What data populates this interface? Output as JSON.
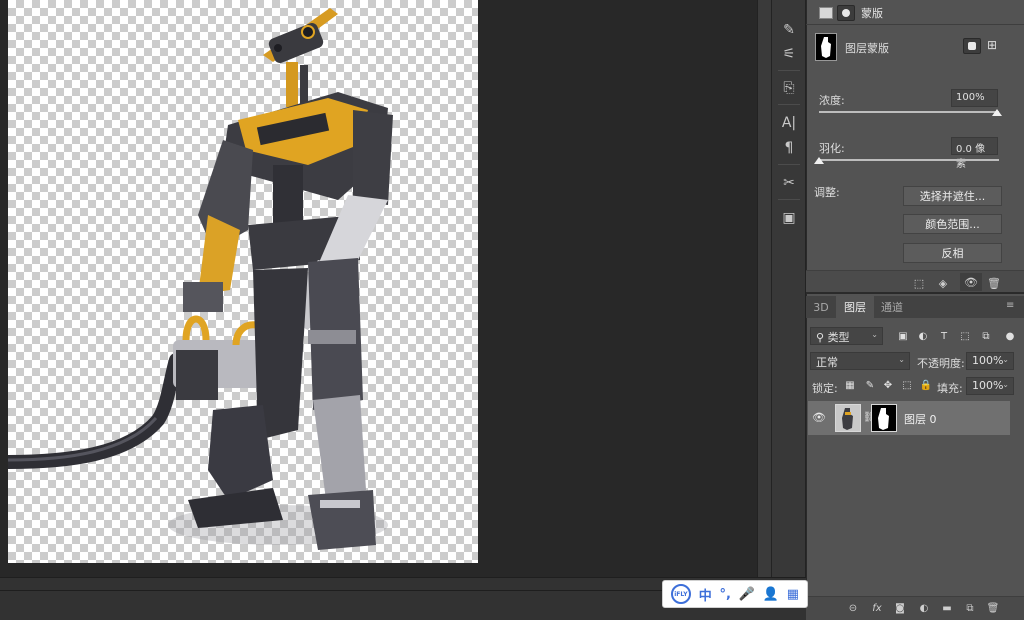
{
  "properties": {
    "header_label": "蒙版",
    "mask_title": "图层蒙版",
    "density_label": "浓度:",
    "density_value": "100%",
    "feather_label": "羽化:",
    "feather_value": "0.0 像素",
    "refine_label": "调整:",
    "select_and_mask_button": "选择并遮住...",
    "color_range_button": "颜色范围...",
    "invert_button": "反相"
  },
  "layers": {
    "tabs": [
      "3D",
      "图层",
      "通道"
    ],
    "active_tab": "图层",
    "filter_kind": "类型",
    "blend_mode": "正常",
    "opacity_label": "不透明度:",
    "opacity_value": "100%",
    "lock_label": "锁定:",
    "fill_label": "填充:",
    "fill_value": "100%",
    "layer_name": "图层 0"
  },
  "ime": {
    "logo": "iFLY",
    "mode": "中",
    "punct": "°,",
    "mic": "🎤",
    "user": "👤",
    "apps": "▦"
  },
  "icons": {
    "tool_column": [
      "history-brush-icon",
      "brush-settings-icon",
      "clone-source-icon",
      "character-icon",
      "paragraph-icon",
      "tools-icon",
      "glyph-icon"
    ],
    "properties_footer": [
      "load-selection-icon",
      "apply-mask-icon",
      "visibility-icon",
      "delete-mask-icon"
    ],
    "layers_footer": [
      "link-icon",
      "fx-icon",
      "add-mask-icon",
      "adjustment-icon",
      "folder-icon",
      "new-layer-icon",
      "trash-icon"
    ]
  },
  "colors": {
    "panel_bg": "#535353",
    "canvas_bg": "#282828",
    "robot_accent": "#e0a422",
    "ime_accent": "#3d6fd9"
  }
}
